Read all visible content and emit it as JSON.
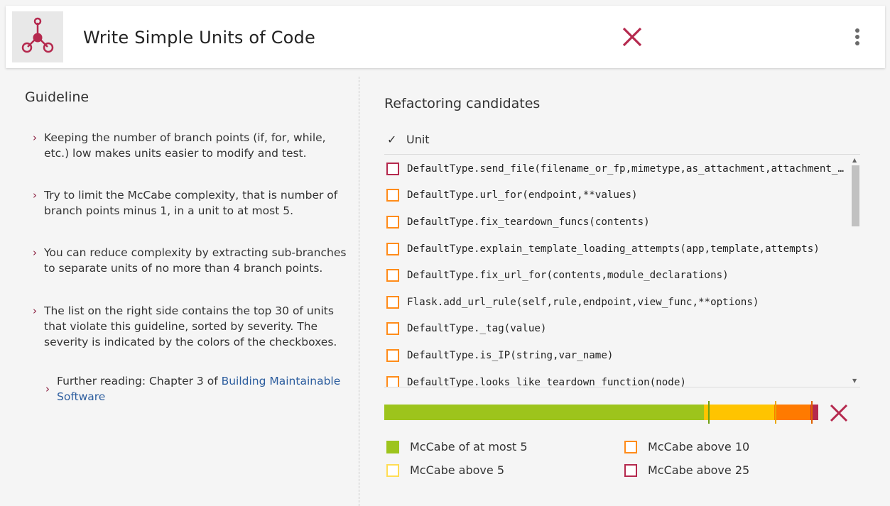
{
  "header": {
    "title": "Write Simple Units of Code",
    "logo_icon": "network-node-icon",
    "close_icon": "close-icon",
    "menu_icon": "kebab-menu-icon",
    "accent_color": "#b5294e"
  },
  "guideline": {
    "title": "Guideline",
    "items": [
      "Keeping the number of branch points (if, for, while, etc.) low makes units easier to modify and test.",
      "Try to limit the McCabe complexity, that is number of branch points minus 1, in a unit to at most 5.",
      "You can reduce complexity by extracting sub-branches to separate units of no more than 4 branch points.",
      "The list on the right side contains the top 30 of units that violate this guideline, sorted by severity. The severity is indicated by the colors of the checkboxes."
    ],
    "further_reading_prefix": "Further reading: Chapter 3 of ",
    "further_reading_link": "Building Maintainable Software"
  },
  "refactoring": {
    "title": "Refactoring candidates",
    "column_header": "Unit",
    "units": [
      {
        "name": "DefaultType.send_file(filename_or_fp,mimetype,as_attachment,attachment_filename,add_etags,cache_timeout,conditional)",
        "severity": "above_25"
      },
      {
        "name": "DefaultType.url_for(endpoint,**values)",
        "severity": "above_10"
      },
      {
        "name": "DefaultType.fix_teardown_funcs(contents)",
        "severity": "above_10"
      },
      {
        "name": "DefaultType.explain_template_loading_attempts(app,template,attempts)",
        "severity": "above_10"
      },
      {
        "name": "DefaultType.fix_url_for(contents,module_declarations)",
        "severity": "above_10"
      },
      {
        "name": "Flask.add_url_rule(self,rule,endpoint,view_func,**options)",
        "severity": "above_10"
      },
      {
        "name": "DefaultType._tag(value)",
        "severity": "above_10"
      },
      {
        "name": "DefaultType.is_IP(string,var_name)",
        "severity": "above_10"
      },
      {
        "name": "DefaultType.looks_like_teardown_function(node)",
        "severity": "above_10"
      }
    ],
    "distribution": [
      {
        "key": "at_most_5",
        "fraction": 0.737
      },
      {
        "key": "above_5",
        "fraction": 0.162
      },
      {
        "key": "above_10",
        "fraction": 0.083
      },
      {
        "key": "above_25",
        "fraction": 0.018
      }
    ]
  },
  "legend": [
    {
      "key": "at_most_5",
      "label": "McCabe of at most 5",
      "color": "#9dc41c",
      "filled": true
    },
    {
      "key": "above_10",
      "label": "McCabe above 10",
      "color": "#ff8c1a",
      "filled": false
    },
    {
      "key": "above_5",
      "label": "McCabe above 5",
      "color": "#ffdd55",
      "filled": false
    },
    {
      "key": "above_25",
      "label": "McCabe above 25",
      "color": "#b5294e",
      "filled": false
    }
  ],
  "colors": {
    "at_most_5": "#9dc41c",
    "above_5": "#ffc400",
    "above_10": "#ff7a00",
    "above_25": "#b5294e"
  }
}
